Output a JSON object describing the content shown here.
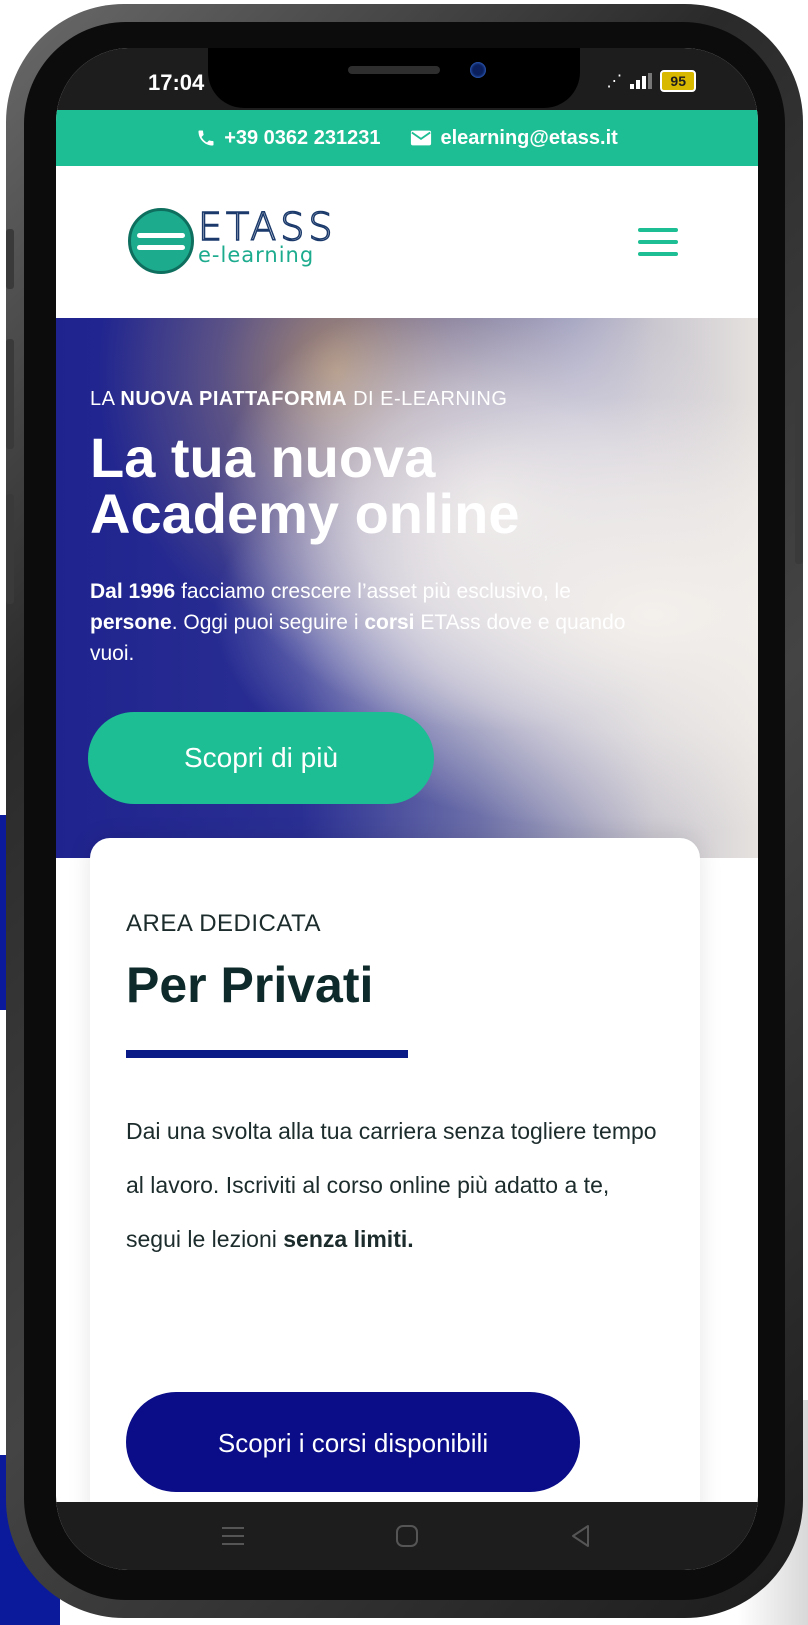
{
  "status_bar": {
    "time": "17:04",
    "battery": "95"
  },
  "contact": {
    "phone": "+39 0362 231231",
    "email": "elearning@etass.it"
  },
  "logo": {
    "name": "ETASS",
    "subtitle": "e-learning"
  },
  "hero": {
    "kicker_pre": "LA ",
    "kicker_bold": "NUOVA PIATTAFORMA",
    "kicker_post": " DI E-LEARNING",
    "title": "La tua nuova Academy online",
    "text_bold_1": "Dal 1996",
    "text_1": " facciamo crescere l’asset più esclusivo, le ",
    "text_bold_2": "persone",
    "text_2": ". Oggi puoi seguire i ",
    "text_bold_3": "corsi",
    "text_3": " ETAss dove e quando vuoi.",
    "button_label": "Scopri di più"
  },
  "card": {
    "kicker": "AREA DEDICATA",
    "title": "Per Privati",
    "text": "Dai una svolta alla tua carriera senza togliere tempo al lavoro. Iscriviti al corso online più adatto a te, segui le lezioni ",
    "text_bold": "senza limiti.",
    "button_label": "Scopri i corsi disponibili"
  },
  "colors": {
    "accent_green": "#1dbe93",
    "brand_navy": "#0a0d87",
    "hero_blue": "#1f238e"
  },
  "icons": {
    "phone": "phone-icon",
    "email": "mail-icon",
    "menu": "hamburger-menu-icon",
    "nav_recent": "recent-apps-icon",
    "nav_home": "home-icon",
    "nav_back": "back-icon"
  }
}
